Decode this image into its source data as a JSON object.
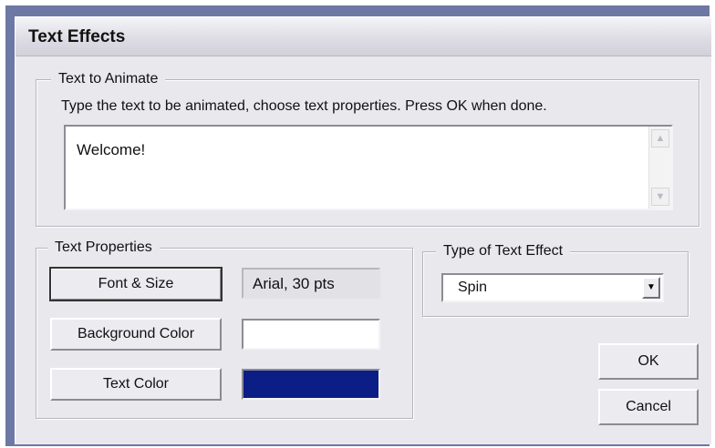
{
  "dialog": {
    "title": "Text Effects",
    "ok_label": "OK",
    "cancel_label": "Cancel"
  },
  "text_to_animate": {
    "legend": "Text to Animate",
    "instruction": "Type the text to be animated, choose text properties. Press OK when done.",
    "value": "Welcome!"
  },
  "text_properties": {
    "legend": "Text Properties",
    "font_button_label": "Font & Size",
    "font_value": "Arial, 30 pts",
    "background_button_label": "Background Color",
    "background_color": "#ffffff",
    "text_color_button_label": "Text Color",
    "text_color": "#0a1e86"
  },
  "effect": {
    "legend": "Type of Text Effect",
    "selected": "Spin"
  },
  "icons": {
    "scroll_up": "chevron-up-icon",
    "scroll_down": "chevron-down-icon",
    "dropdown": "triangle-down-icon"
  }
}
